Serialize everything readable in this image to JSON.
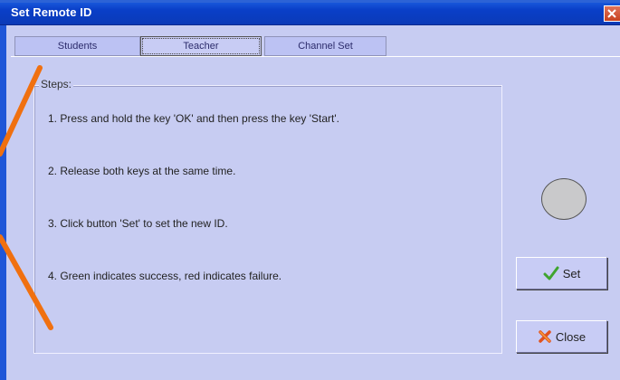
{
  "window": {
    "title": "Set Remote ID"
  },
  "tabs": [
    {
      "label": "Students",
      "active": false
    },
    {
      "label": "Teacher",
      "active": true
    },
    {
      "label": "Channel Set",
      "active": false
    }
  ],
  "steps": {
    "legend": "Steps:",
    "items": [
      "1. Press and hold the key 'OK' and then press the key 'Start'.",
      "2. Release both keys at the same time.",
      "3. Click button 'Set' to set the new ID.",
      "4. Green indicates success, red indicates failure."
    ]
  },
  "status_indicator": {
    "color": "#c9c9cb"
  },
  "buttons": {
    "set_label": "Set",
    "set_icon": "checkmark-icon",
    "close_label": "Close",
    "close_icon": "x-icon"
  },
  "colors": {
    "dialog_background": "#c7ccf2",
    "titlebar": "#0a3fc8",
    "annotation": "#f07010"
  }
}
